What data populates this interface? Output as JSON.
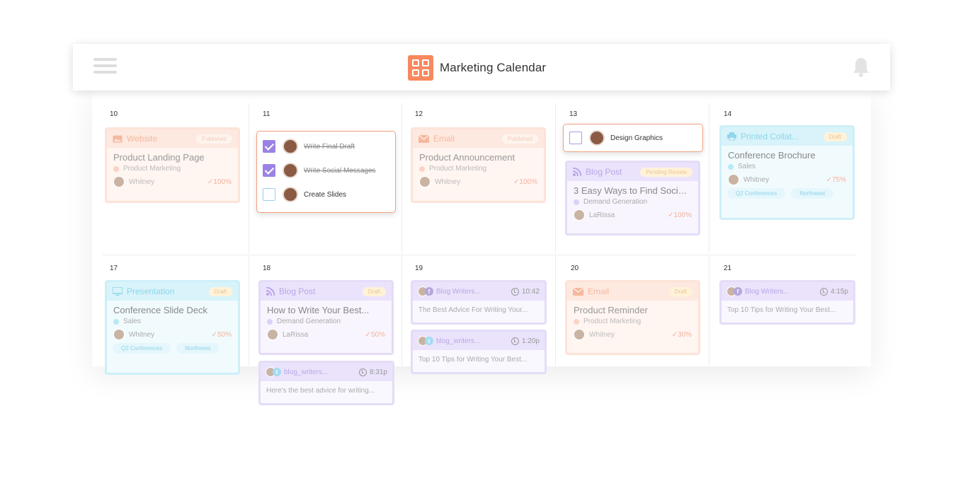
{
  "header": {
    "title": "Marketing Calendar"
  },
  "days": [
    {
      "num": "10"
    },
    {
      "num": "11"
    },
    {
      "num": "12"
    },
    {
      "num": "13"
    },
    {
      "num": "14"
    },
    {
      "num": "17"
    },
    {
      "num": "18"
    },
    {
      "num": "19"
    },
    {
      "num": "20"
    },
    {
      "num": "21"
    }
  ],
  "cards": {
    "d10_website": {
      "type": "Website",
      "badge": "Published",
      "title": "Product Landing Page",
      "team": "Product Marketing",
      "owner": "Whitney",
      "progress": "100%"
    },
    "d12_email": {
      "type": "Email",
      "badge": "Published",
      "title": "Product Announcement",
      "team": "Product Marketing",
      "owner": "Whitney",
      "progress": "100%"
    },
    "d13_blog": {
      "type": "Blog Post",
      "badge": "Pending Review",
      "title": "3 Easy Ways to Find Social...",
      "team": "Demand Generation",
      "owner": "LaRissa",
      "progress": "100%"
    },
    "d14_print": {
      "type": "Printed Collat...",
      "badge": "Draft",
      "title": "Conference Brochure",
      "team": "Sales",
      "owner": "Whitney",
      "progress": "75%",
      "tags": [
        "Q2 Conferences",
        "Northwest"
      ]
    },
    "d17_pres": {
      "type": "Presentation",
      "badge": "Draft",
      "title": "Conference Slide Deck",
      "team": "Sales",
      "owner": "Whitney",
      "progress": "50%",
      "tags": [
        "Q2 Conferences",
        "Northwest"
      ]
    },
    "d18_blog": {
      "type": "Blog Post",
      "badge": "Draft",
      "title": "How to Write Your Best...",
      "team": "Demand Generation",
      "owner": "LaRissa",
      "progress": "50%"
    },
    "d20_email": {
      "type": "Email",
      "badge": "Draft",
      "title": "Product Reminder",
      "team": "Product Marketing",
      "owner": "Whitney",
      "progress": "30%"
    }
  },
  "posts": {
    "d18_tw": {
      "account": "blog_writers...",
      "time": "8:31p",
      "text": "Here's the best advice for writing..."
    },
    "d19_fb": {
      "account": "Blog Writers...",
      "time": "10:42",
      "text": "The Best Advice For Writing Your..."
    },
    "d19_tw": {
      "account": "blog_writers...",
      "time": "1:20p",
      "text": "Top 10 Tips for Writing Your Best..."
    },
    "d21_fb": {
      "account": "Blog Writers...",
      "time": "4:15p",
      "text": "Top 10 Tips for Writing Your Best..."
    }
  },
  "tasks": {
    "d11": [
      {
        "label": "Write Final Draft",
        "done": true
      },
      {
        "label": "Write Social Messages",
        "done": true
      },
      {
        "label": "Create Slides",
        "done": false
      }
    ],
    "d13": [
      {
        "label": "Design Graphics",
        "done": false
      }
    ]
  },
  "colors": {
    "accent": "#f7895f",
    "purple": "#9a83e4",
    "blue": "#8ed6ea"
  },
  "icons": {
    "menu": "hamburger-icon",
    "logo": "grid-logo-icon",
    "bell": "bell-icon",
    "check": "check-icon",
    "clock": "clock-icon"
  }
}
